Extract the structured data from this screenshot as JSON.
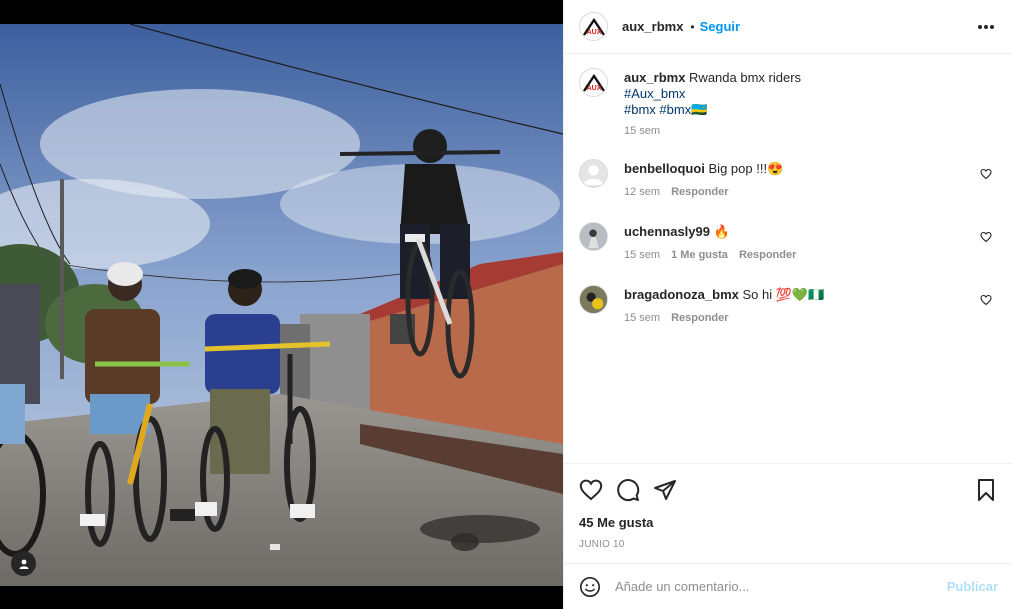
{
  "post": {
    "author": "aux_rbmx",
    "follow_label": "Seguir",
    "separator": "•",
    "avatar_text": "AUX"
  },
  "caption": {
    "username": "aux_rbmx",
    "text": "Rwanda bmx riders",
    "hashtag_line1": "#Aux_bmx",
    "hashtag_line2": "#bmx #bmx🇷🇼",
    "time": "15 sem"
  },
  "comments": [
    {
      "username": "benbelloquoi",
      "text": "Big pop !!!😍",
      "time": "12 sem",
      "likes": "",
      "reply": "Responder"
    },
    {
      "username": "uchennasly99",
      "text": "🔥",
      "time": "15 sem",
      "likes": "1 Me gusta",
      "reply": "Responder"
    },
    {
      "username": "bragadonoza_bmx",
      "text": "So hi 💯💚🇳🇬",
      "time": "15 sem",
      "likes": "",
      "reply": "Responder"
    }
  ],
  "engagement": {
    "likes": "45 Me gusta",
    "date": "JUNIO 10"
  },
  "composer": {
    "placeholder": "Añade un comentario...",
    "publish_label": "Publicar"
  },
  "icons": {
    "like": "heart-icon",
    "comment": "comment-icon",
    "share": "share-icon",
    "save": "bookmark-icon",
    "emoji": "emoji-icon",
    "more": "more-icon",
    "tag": "user-tag-icon"
  },
  "colors": {
    "accent": "#0095f6",
    "hashtag": "#00376b",
    "muted": "#8e8e8e",
    "publish_disabled": "#b2dffc"
  }
}
